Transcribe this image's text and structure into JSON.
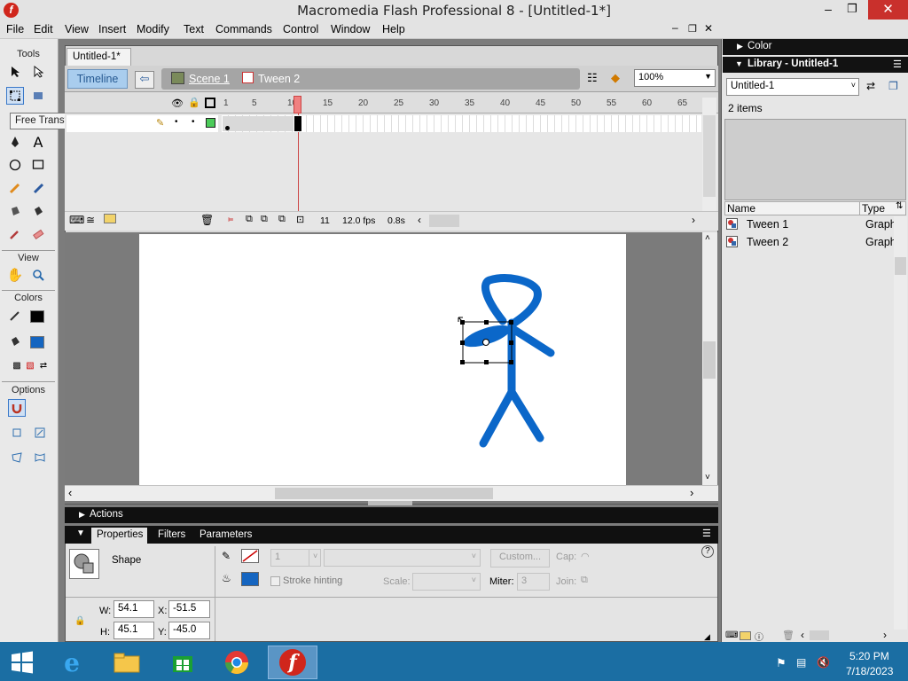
{
  "window": {
    "title": "Macromedia Flash Professional 8 - [Untitled-1*]"
  },
  "menu": [
    "File",
    "Edit",
    "View",
    "Insert",
    "Modify",
    "Text",
    "Commands",
    "Control",
    "Window",
    "Help"
  ],
  "tools": {
    "header": "Tools",
    "view_header": "View",
    "colors_header": "Colors",
    "options_header": "Options",
    "tooltip": "Free Transform Tool (Q)"
  },
  "document": {
    "tab": "Untitled-1*",
    "timeline_button": "Timeline",
    "scene": "Scene 1",
    "symbol": "Tween 2",
    "zoom": "100%"
  },
  "timeline": {
    "frame_numbers": [
      "1",
      "5",
      "10",
      "15",
      "20",
      "25",
      "30",
      "35",
      "40",
      "45",
      "50",
      "55",
      "60",
      "65"
    ],
    "current_frame": "11",
    "fps": "12.0 fps",
    "elapsed": "0.8s"
  },
  "panels": {
    "actions": "Actions",
    "tabs": [
      "Properties",
      "Filters",
      "Parameters"
    ]
  },
  "properties": {
    "type": "Shape",
    "w_label": "W:",
    "w": "54.1",
    "x_label": "X:",
    "x": "-51.5",
    "h_label": "H:",
    "h": "45.1",
    "y_label": "Y:",
    "y": "-45.0",
    "stroke_size": "1",
    "custom_button": "Custom...",
    "cap_label": "Cap:",
    "stroke_hinting": "Stroke hinting",
    "scale_label": "Scale:",
    "miter_label": "Miter:",
    "miter": "3",
    "join_label": "Join:"
  },
  "color_panel": {
    "title": "Color"
  },
  "library": {
    "title": "Library - Untitled-1",
    "selected_doc": "Untitled-1",
    "count": "2 items",
    "col_name": "Name",
    "col_type": "Type",
    "items": [
      {
        "name": "Tween 1",
        "type": "Graph"
      },
      {
        "name": "Tween 2",
        "type": "Graph"
      }
    ]
  },
  "taskbar": {
    "time": "5:20 PM",
    "date": "7/18/2023"
  },
  "colors": {
    "stroke_color": "#000000",
    "fill_color": "#1565c0",
    "figure_blue": "#0b67c9"
  }
}
